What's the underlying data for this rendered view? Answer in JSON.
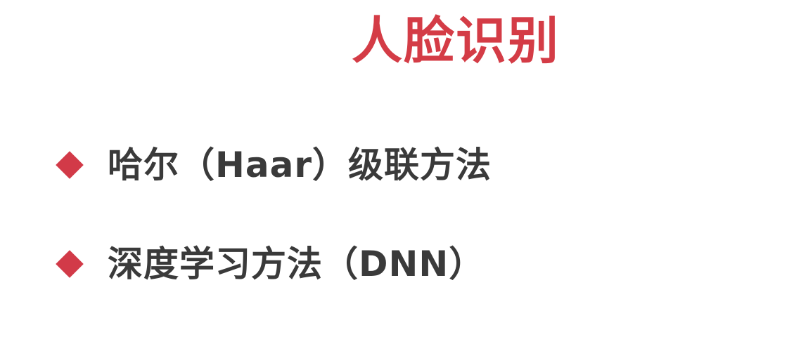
{
  "slide": {
    "title": "人脸识别",
    "bullets": [
      {
        "text": "哈尔（Haar）级联方法",
        "marker_icon": "diamond-bullet-icon"
      },
      {
        "text": "深度学习方法（DNN）",
        "marker_icon": "diamond-bullet-icon"
      }
    ]
  },
  "colors": {
    "title": "#d43c46",
    "bullet_marker": "#d23a48",
    "bullet_text": "#3a3a3a",
    "background": "#ffffff"
  }
}
